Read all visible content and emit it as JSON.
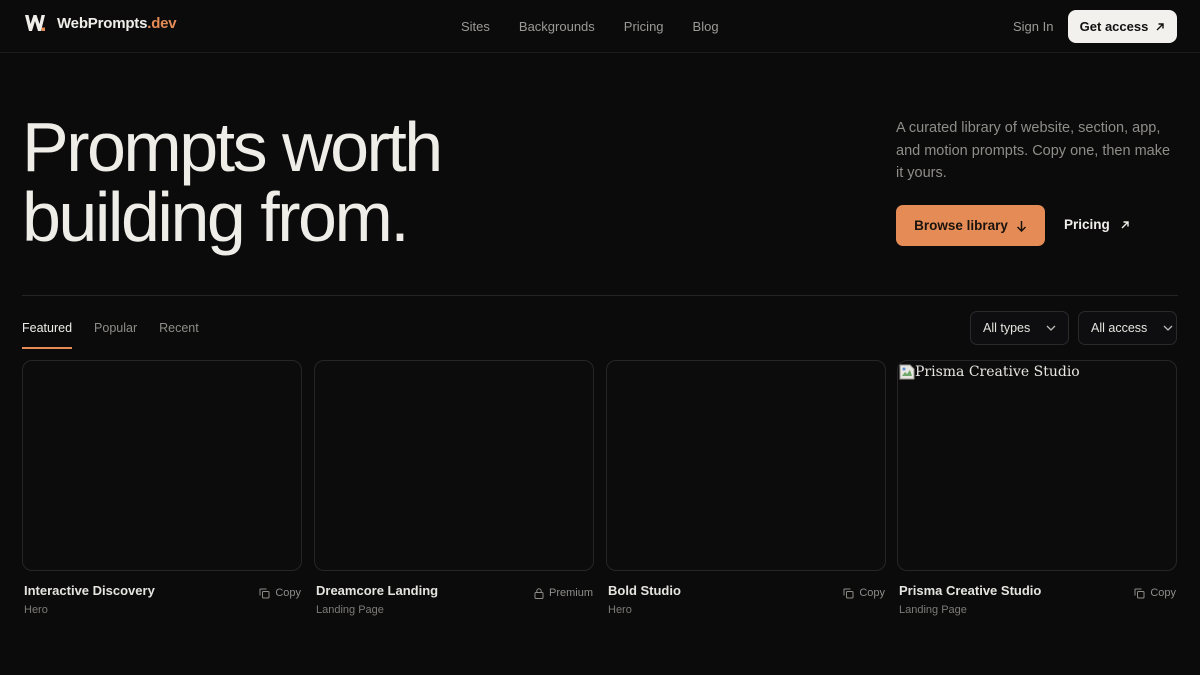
{
  "brand": {
    "name": "WebPrompts",
    "suffix": ".dev"
  },
  "nav": {
    "items": [
      "Sites",
      "Backgrounds",
      "Pricing",
      "Blog"
    ]
  },
  "header": {
    "signin": "Sign In",
    "cta": "Get access"
  },
  "hero": {
    "title_line1": "Prompts worth",
    "title_line2": "building from.",
    "description": "A curated library of website, section, app, and motion prompts. Copy one, then make it yours.",
    "browse": "Browse library",
    "pricing": "Pricing"
  },
  "tabs": [
    "Featured",
    "Popular",
    "Recent"
  ],
  "filters": {
    "types": "All types",
    "access": "All access"
  },
  "cards": [
    {
      "title": "Interactive Discovery",
      "category": "Hero",
      "action": "Copy",
      "action_icon": "copy-icon"
    },
    {
      "title": "Dreamcore Landing",
      "category": "Landing Page",
      "action": "Premium",
      "action_icon": "lock-icon"
    },
    {
      "title": "Bold Studio",
      "category": "Hero",
      "action": "Copy",
      "action_icon": "copy-icon"
    },
    {
      "title": "Prisma Creative Studio",
      "category": "Landing Page",
      "action": "Copy",
      "action_icon": "copy-icon",
      "image_alt": "Prisma Creative Studio"
    }
  ],
  "colors": {
    "background": "#0b0b0c",
    "accent": "#e58c56",
    "text": "#efede8",
    "muted": "#8f8d88"
  }
}
